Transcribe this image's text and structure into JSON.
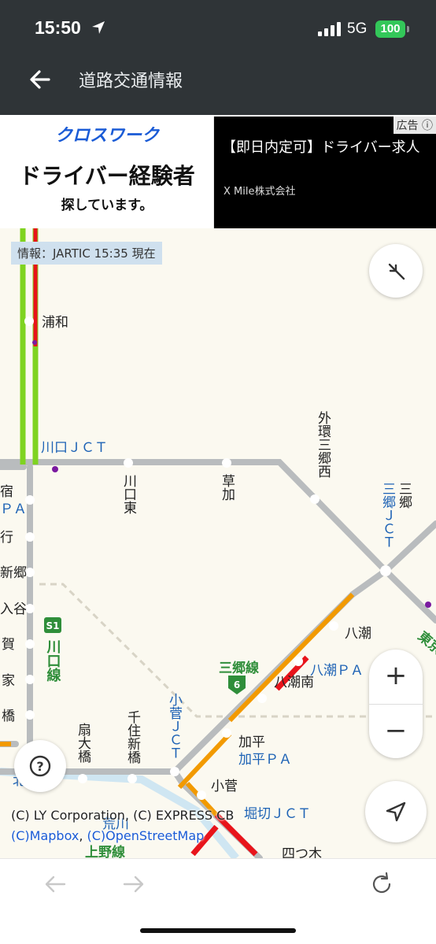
{
  "status": {
    "time": "15:50",
    "network": "5G",
    "battery": "100"
  },
  "header": {
    "title": "道路交通情報"
  },
  "ad": {
    "brand": "クロスワーク",
    "headline": "ドライバー経験者",
    "subline": "探しています。",
    "title": "【即日内定可】ドライバー求人",
    "company": "X Mile株式会社",
    "tag": "広告"
  },
  "map": {
    "info": "情報：JARTIC 15:35 現在",
    "labels": {
      "urawa": "浦和",
      "kawaguchi_jct": "川口ＪＣＴ",
      "kawaguchi_higashi": "川口東",
      "souka": "草加",
      "gaikan_misato_nishi": "外環三郷西",
      "misato_jct": "三郷ＪＣＴ",
      "misato": "三郷",
      "yashio": "八潮",
      "yashio_pa": "八潮ＰＡ",
      "yashio_minami": "八潮南",
      "misato_line": "三郷線",
      "kahei": "加平",
      "kahei_pa": "加平ＰＡ",
      "kosuge_jct": "小菅ＪＣＴ",
      "kosuge": "小菅",
      "ohashi": "扇大橋",
      "senju_shinbashi": "千住新橋",
      "kawaguchi_line": "川口線",
      "route_s1": "S1",
      "route_6": "6",
      "higashi": "東京",
      "juku": "宿",
      "pa": "ＰＡ",
      "gyo": "行",
      "shingo": "新郷",
      "iriya": "入谷",
      "ka": "賀",
      "ka2": "家",
      "hashi": "橋",
      "horikiri_jct": "堀切ＪＣＴ",
      "ueno_line": "上野線",
      "arakawa": "荒川",
      "yotsugi": "四つ木",
      "kita": "北",
      "e": "江"
    },
    "attribution_1": "(C) LY Corporation, (C) EXPRESS CB",
    "attribution_2a": "(C)Mapbox",
    "attribution_2b": "(C)OpenStreetMap"
  },
  "colors": {
    "bar": "#2f3437",
    "road": "#b9bcbe",
    "green": "#7fd321",
    "red": "#e8141b",
    "orange": "#f29a00",
    "label_blue": "#1d62b5",
    "label_green": "#2f8e3a"
  }
}
